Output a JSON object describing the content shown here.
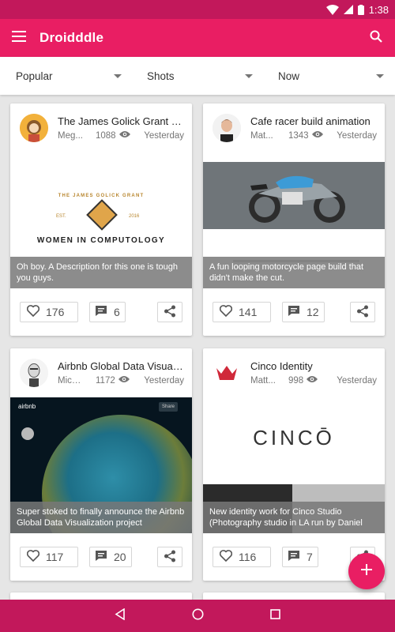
{
  "status_bar": {
    "time": "1:38"
  },
  "app_bar": {
    "title": "Droidddle"
  },
  "filters": [
    {
      "label": "Popular"
    },
    {
      "label": "Shots"
    },
    {
      "label": "Now"
    }
  ],
  "cards": [
    {
      "title": "The James Golick Grant fo...",
      "author": "Meg...",
      "views": "1088",
      "time": "Yesterday",
      "caption": "Oh boy. A Description for this one is tough you guys.",
      "shot_text": {
        "top_arc": "THE JAMES GOLICK GRANT",
        "est": "EST.",
        "year": "2016",
        "main": "WOMEN IN COMPUTOLOGY"
      },
      "likes": "176",
      "comments": "6"
    },
    {
      "title": "Cafe racer build animation",
      "author": "Mat...",
      "views": "1343",
      "time": "Yesterday",
      "caption": "A fun looping motorcycle page build that didn't make the cut.",
      "likes": "141",
      "comments": "12"
    },
    {
      "title": "Airbnb Global Data Visualiz...",
      "author": "Mich...",
      "views": "1172",
      "time": "Yesterday",
      "caption": "Super stoked to finally announce the Airbnb Global Data Visualization project",
      "shot_text": {
        "brand": "airbnb",
        "share": "Share"
      },
      "likes": "117",
      "comments": "20"
    },
    {
      "title": "Cinco Identity",
      "author": "Matt...",
      "views": "998",
      "time": "Yesterday",
      "caption": "New identity work for Cinco Studio (Photography studio in LA run by Daniel",
      "shot_text": {
        "logo": "CINCŌ"
      },
      "likes": "116",
      "comments": "7"
    }
  ],
  "colors": {
    "primary": "#e91e63",
    "primary_dark": "#c2185b",
    "background": "#e6e6e6"
  }
}
